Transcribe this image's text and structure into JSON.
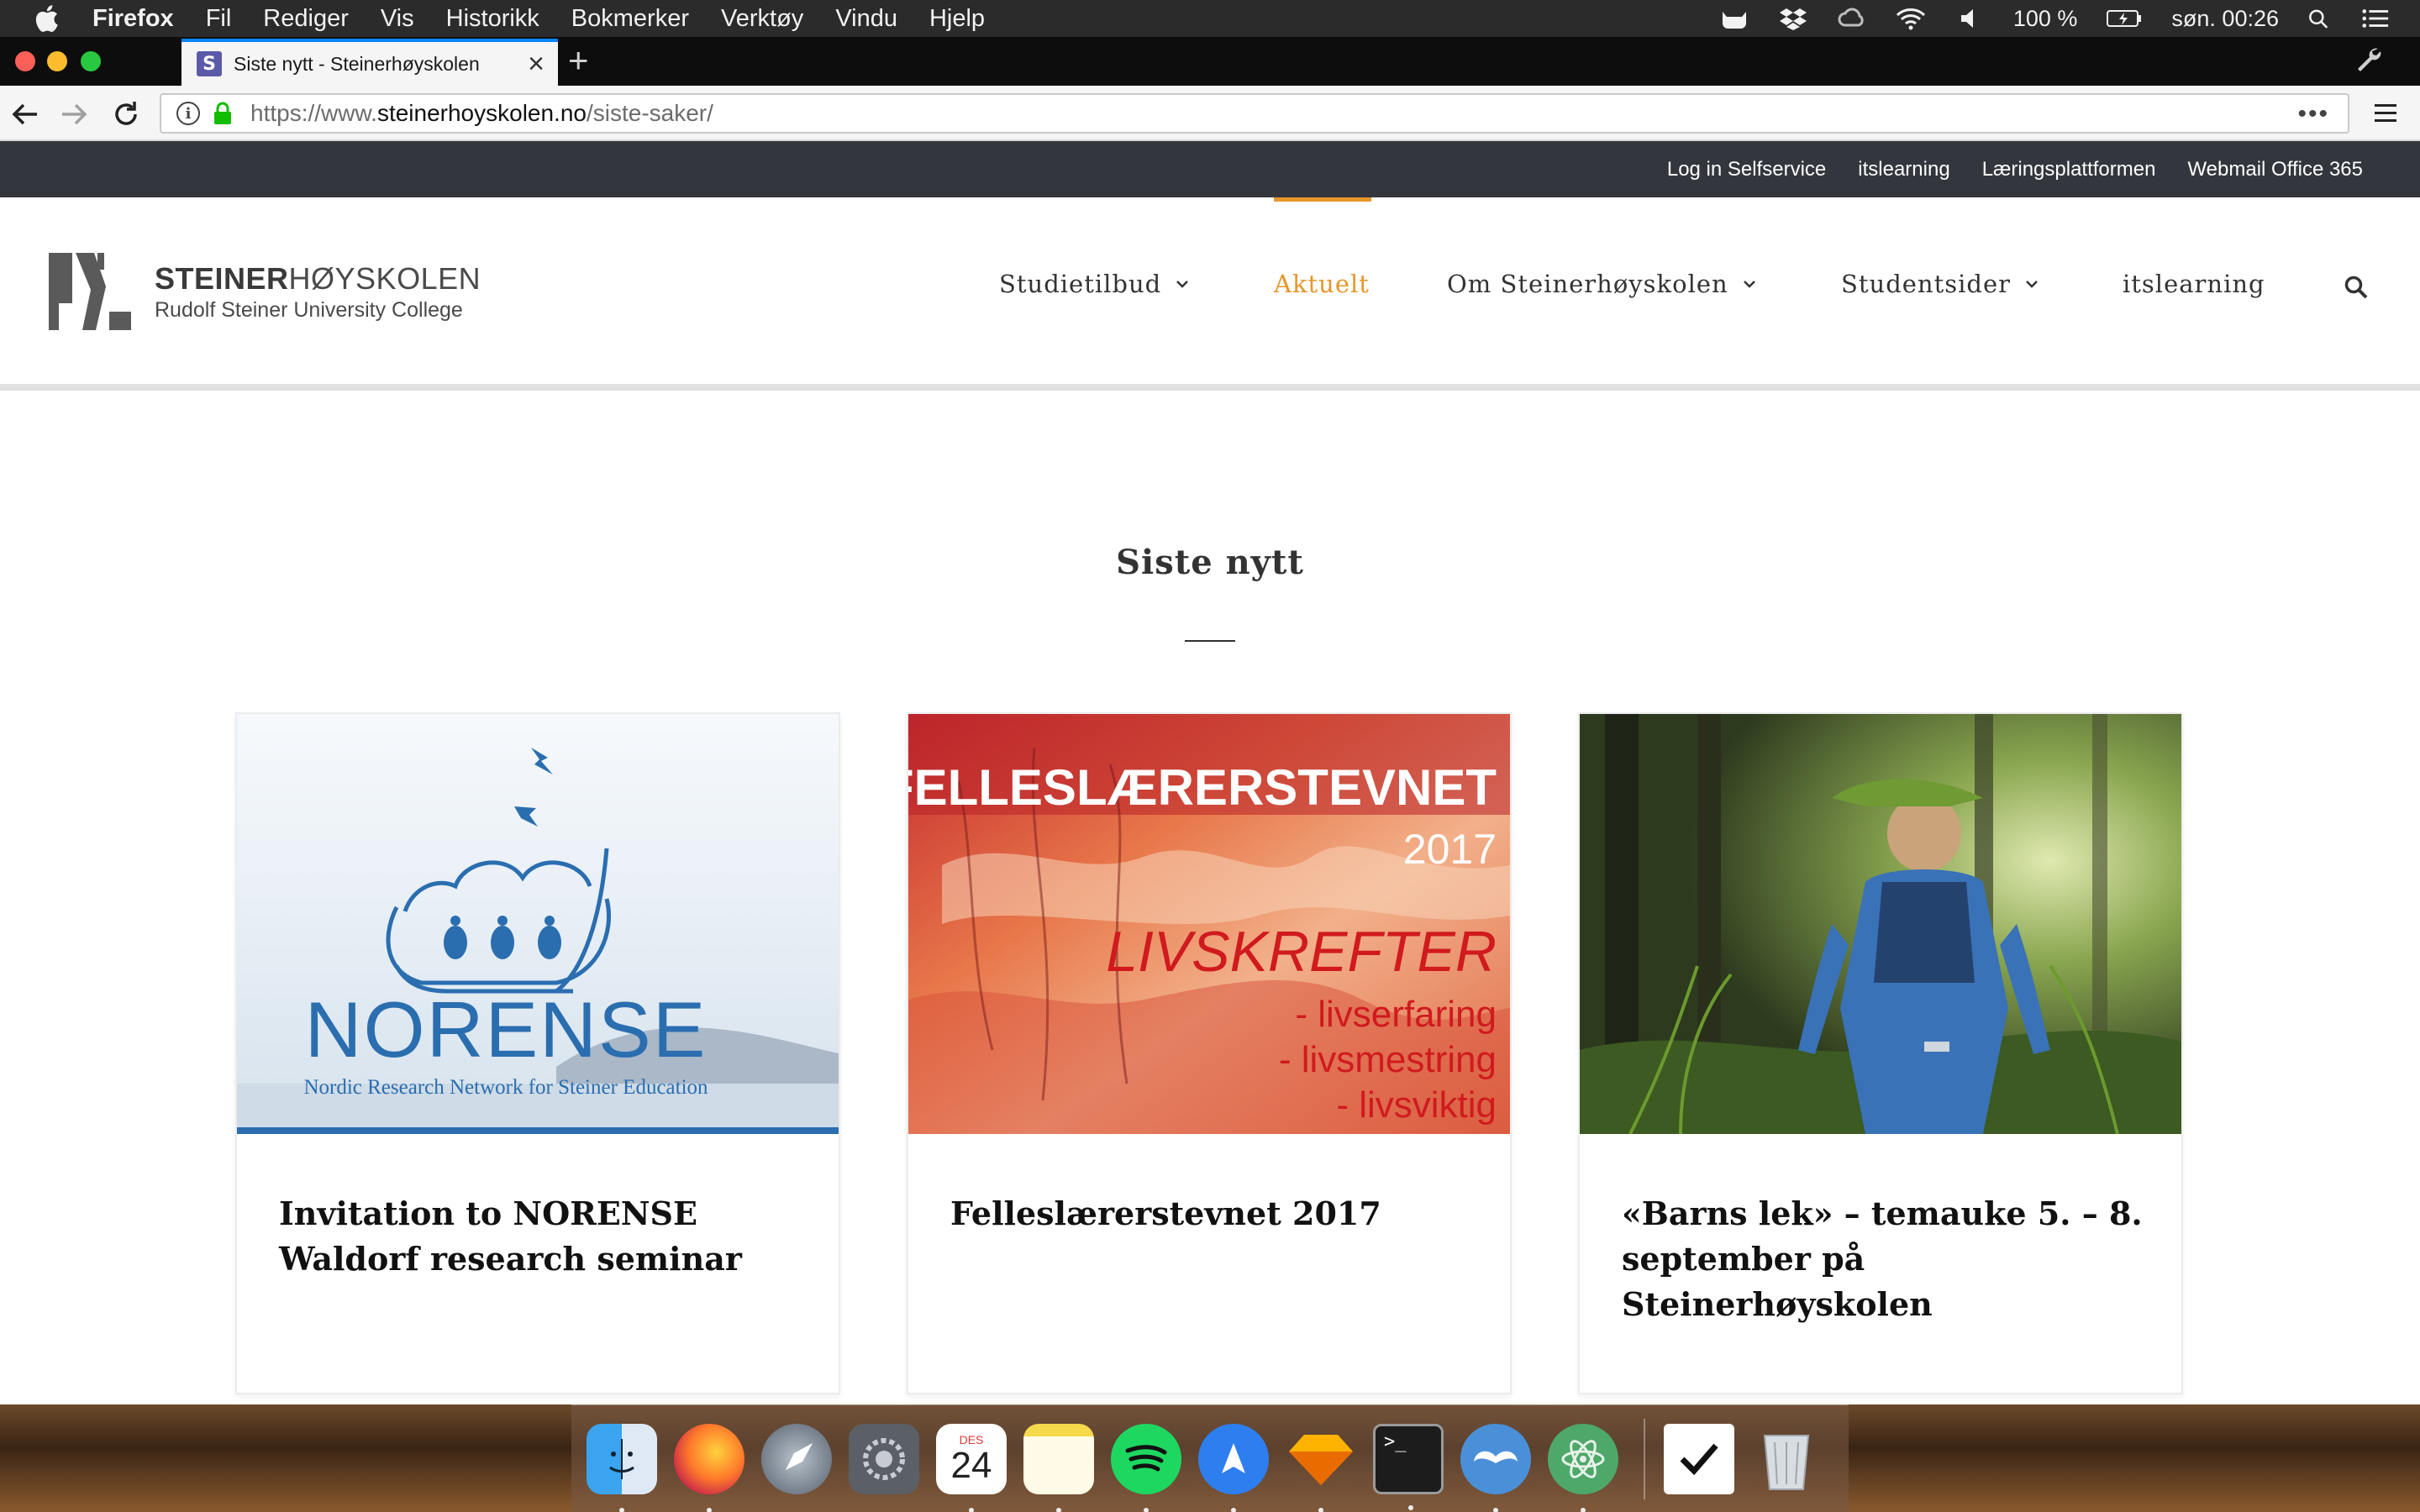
{
  "menubar": {
    "app_name": "Firefox",
    "menus": [
      "Fil",
      "Rediger",
      "Vis",
      "Historikk",
      "Bokmerker",
      "Verktøy",
      "Vindu",
      "Hjelp"
    ],
    "battery": "100 %",
    "clock": "søn. 00:26"
  },
  "browser": {
    "tab_title": "Siste nytt - Steinerhøyskolen",
    "url_prefix": "https://www.",
    "url_domain": "steinerhoyskolen.no",
    "url_path": "/siste-saker/",
    "overflow_label": "•••"
  },
  "site": {
    "topbar_links": [
      "Log in Selfservice",
      "itslearning",
      "Læringsplattformen",
      "Webmail Office 365"
    ],
    "logo_name_bold": "STEINER",
    "logo_name_rest": "HØYSKOLEN",
    "logo_sub": "Rudolf Steiner University College",
    "nav": {
      "studietilbud": "Studietilbud",
      "aktuelt": "Aktuelt",
      "om": "Om Steinerhøyskolen",
      "studentsider": "Studentsider",
      "itslearning": "itslearning"
    },
    "accent_color": "#e7962b",
    "section_title": "Siste nytt",
    "cards": [
      {
        "title": "Invitation to NORENSE Waldorf research seminar",
        "image_word": "NORENSE",
        "image_caption": "Nordic Research Network for Steiner Education"
      },
      {
        "title": "Felleslærerstevnet 2017",
        "image_heading": "FELLESLÆRERSTEVNET",
        "image_year": "2017",
        "image_theme": "LIVSKREFTER",
        "image_lines": [
          "- livserfaring",
          "- livsmestring",
          "- livsviktig"
        ]
      },
      {
        "title": "«Barns lek» – temauke 5. – 8. september på Steinerhøyskolen"
      }
    ]
  },
  "dock": {
    "calendar_month": "DES",
    "calendar_day": "24",
    "icons": [
      "finder-icon",
      "firefox-icon",
      "launchpad-icon",
      "system-preferences-icon",
      "calendar-icon",
      "notes-icon",
      "spotify-icon",
      "navigation-app-icon",
      "sketch-icon",
      "terminal-icon",
      "mustache-app-icon",
      "atom-icon",
      "tasks-icon",
      "trash-icon"
    ]
  }
}
